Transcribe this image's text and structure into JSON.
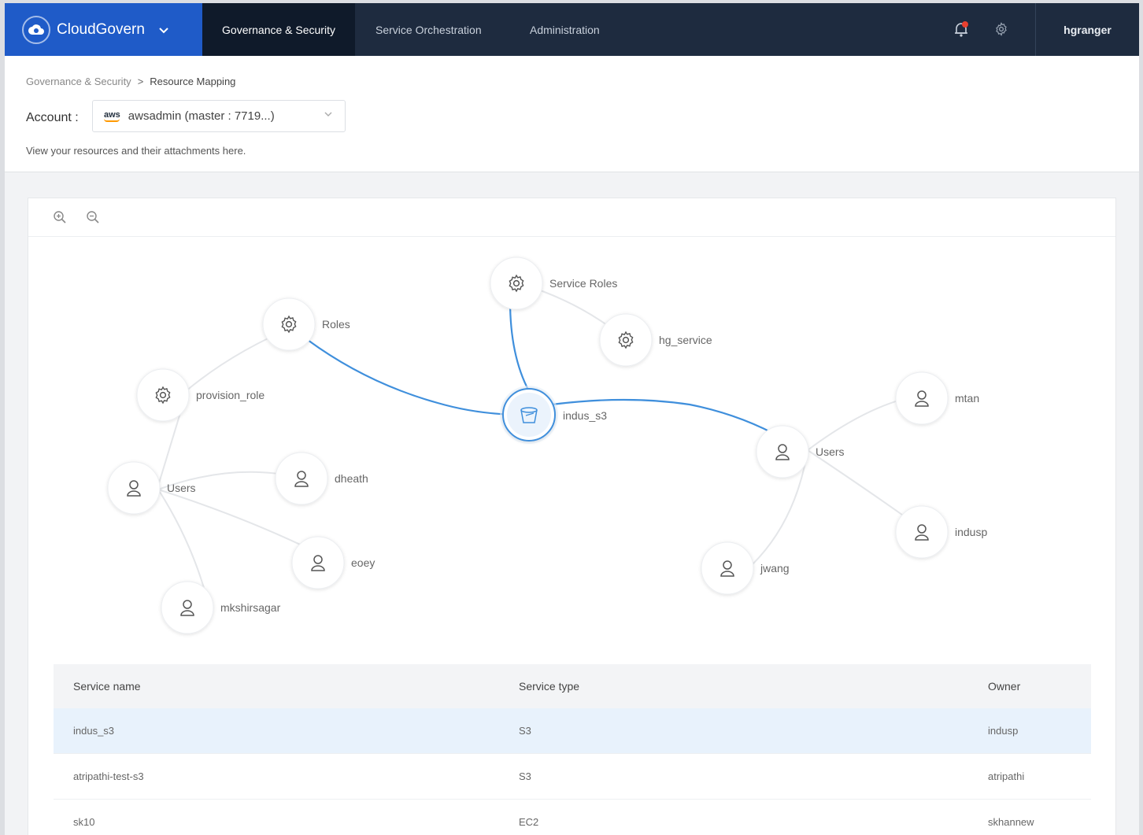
{
  "app": {
    "name": "CloudGovern",
    "user": "hgranger"
  },
  "nav": {
    "tabs": [
      {
        "label": "Governance & Security",
        "active": true
      },
      {
        "label": "Service Orchestration",
        "active": false
      },
      {
        "label": "Administration",
        "active": false
      }
    ],
    "icons": [
      "notification-bell-icon",
      "gear-icon"
    ],
    "colors": {
      "brand": "#1f5bc8",
      "bar": "#1e2b3f",
      "active_tab": "#0f1a2a",
      "alert": "#e8402f"
    }
  },
  "breadcrumb": {
    "parent": "Governance & Security",
    "separator": ">",
    "current": "Resource Mapping"
  },
  "account": {
    "label": "Account :",
    "provider": "aws",
    "value": "awsadmin (master : 7719...)"
  },
  "description": "View your resources and their attachments here.",
  "graph": {
    "center": {
      "label": "indus_s3",
      "icon": "bucket-icon"
    },
    "nodes": [
      {
        "id": "service_roles",
        "label": "Service Roles",
        "icon": "gear-icon"
      },
      {
        "id": "hg_service",
        "label": "hg_service",
        "icon": "gear-icon"
      },
      {
        "id": "roles",
        "label": "Roles",
        "icon": "gear-icon"
      },
      {
        "id": "provision_role",
        "label": "provision_role",
        "icon": "gear-icon"
      },
      {
        "id": "users_left",
        "label": "Users",
        "icon": "user-icon"
      },
      {
        "id": "dheath",
        "label": "dheath",
        "icon": "user-icon"
      },
      {
        "id": "eoey",
        "label": "eoey",
        "icon": "user-icon"
      },
      {
        "id": "mkshirsagar",
        "label": "mkshirsagar",
        "icon": "user-icon"
      },
      {
        "id": "users_right",
        "label": "Users",
        "icon": "user-icon"
      },
      {
        "id": "mtan",
        "label": "mtan",
        "icon": "user-icon"
      },
      {
        "id": "indusp",
        "label": "indusp",
        "icon": "user-icon"
      },
      {
        "id": "jwang",
        "label": "jwang",
        "icon": "user-icon"
      }
    ],
    "edge_color": "#3f8fdc"
  },
  "table": {
    "columns": [
      "Service name",
      "Service type",
      "Owner"
    ],
    "rows": [
      {
        "name": "indus_s3",
        "type": "S3",
        "owner": "indusp",
        "selected": true
      },
      {
        "name": "atripathi-test-s3",
        "type": "S3",
        "owner": "atripathi",
        "selected": false
      },
      {
        "name": "sk10",
        "type": "EC2",
        "owner": "skhannew",
        "selected": false
      }
    ]
  }
}
